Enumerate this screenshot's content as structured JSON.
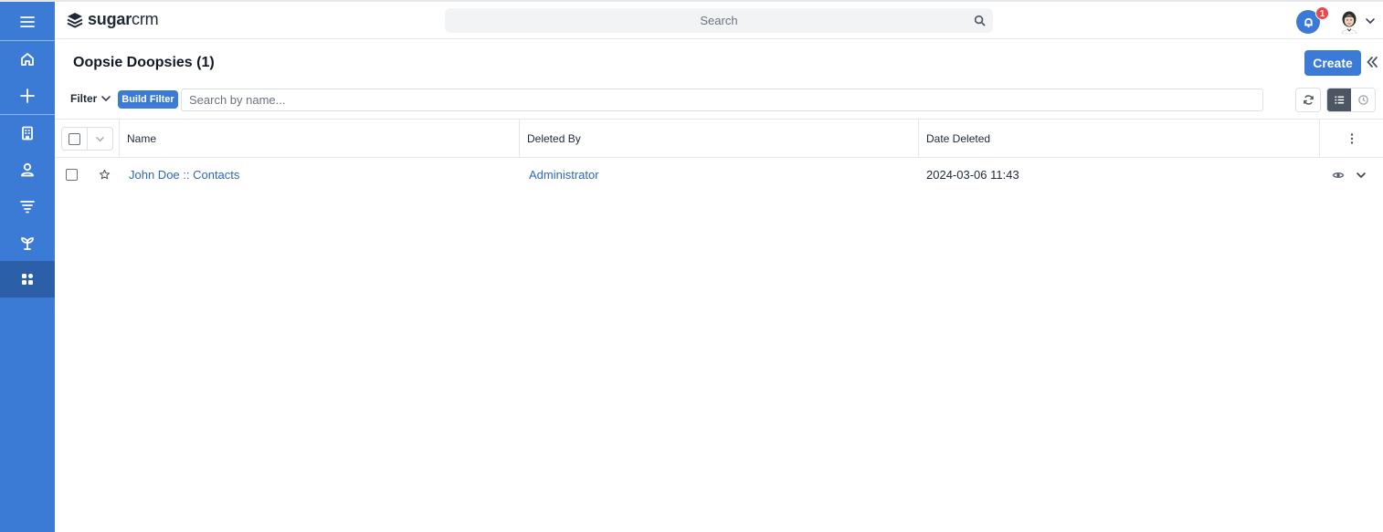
{
  "sidebar": {
    "items": [
      {
        "name": "menu",
        "icon": "hamburger-menu-icon"
      },
      {
        "name": "home",
        "icon": "home-icon"
      },
      {
        "name": "quick-create",
        "icon": "plus-icon"
      },
      {
        "name": "accounts",
        "icon": "building-icon"
      },
      {
        "name": "contacts",
        "icon": "person-icon"
      },
      {
        "name": "leads",
        "icon": "filter-funnel-icon"
      },
      {
        "name": "opportunities",
        "icon": "plant-icon"
      },
      {
        "name": "apps",
        "icon": "grid-icon"
      }
    ],
    "active_item": "apps",
    "color": "#3b7bd6"
  },
  "topbar": {
    "logo_bold": "sugar",
    "logo_light": "crm",
    "search_placeholder": "Search",
    "notification_count": "1"
  },
  "list": {
    "title": "Oopsie Doopsies (1)",
    "create_label": "Create",
    "filter_label": "Filter",
    "build_filter_label": "Build Filter",
    "search_placeholder": "Search by name...",
    "columns": [
      "Name",
      "Deleted By",
      "Date Deleted"
    ],
    "rows": [
      {
        "name": "John Doe :: Contacts",
        "deleted_by": "Administrator",
        "date_deleted": "2024-03-06 11:43"
      }
    ]
  },
  "colors": {
    "accent": "#3b7bd6",
    "link": "#2f67b7",
    "badge": "#e5484d"
  }
}
